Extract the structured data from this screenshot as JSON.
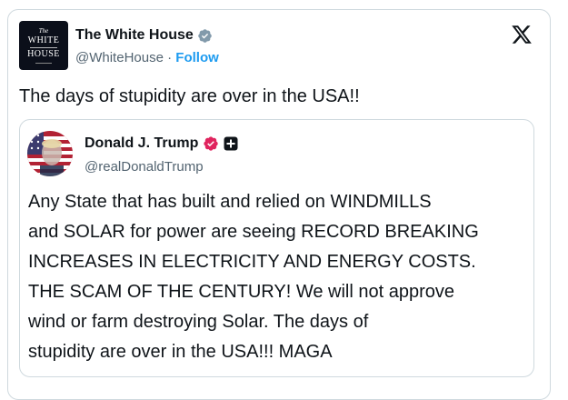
{
  "post": {
    "author_name": "The White House",
    "author_handle": "@WhiteHouse",
    "separator": "·",
    "follow_label": "Follow",
    "avatar_text": {
      "the": "The",
      "line1": "WHITE",
      "line2": "HOUSE"
    },
    "text": "The days of stupidity are over in the USA!!"
  },
  "quoted": {
    "author_name": "Donald J. Trump",
    "author_handle": "@realDonaldTrump",
    "lines": [
      "Any State that has built and relied on WINDMILLS",
      "and SOLAR for power are seeing RECORD BREAKING",
      "INCREASES IN ELECTRICITY AND ENERGY COSTS.",
      "THE SCAM OF THE CENTURY! We will not approve",
      "wind or farm destroying Solar. The days of",
      "stupidity are over in the USA!!! MAGA"
    ]
  },
  "icons": {
    "platform": "x-logo-icon",
    "verified_gov": "gray-verified-badge-icon",
    "verified_quoted": "pink-verified-badge-icon",
    "affiliate": "plus-badge-icon"
  },
  "colors": {
    "follow": "#1d9bf0",
    "gray_badge": "#829aab",
    "pink_badge": "#e0245e",
    "border": "#cfd9de",
    "secondary_text": "#536471"
  }
}
